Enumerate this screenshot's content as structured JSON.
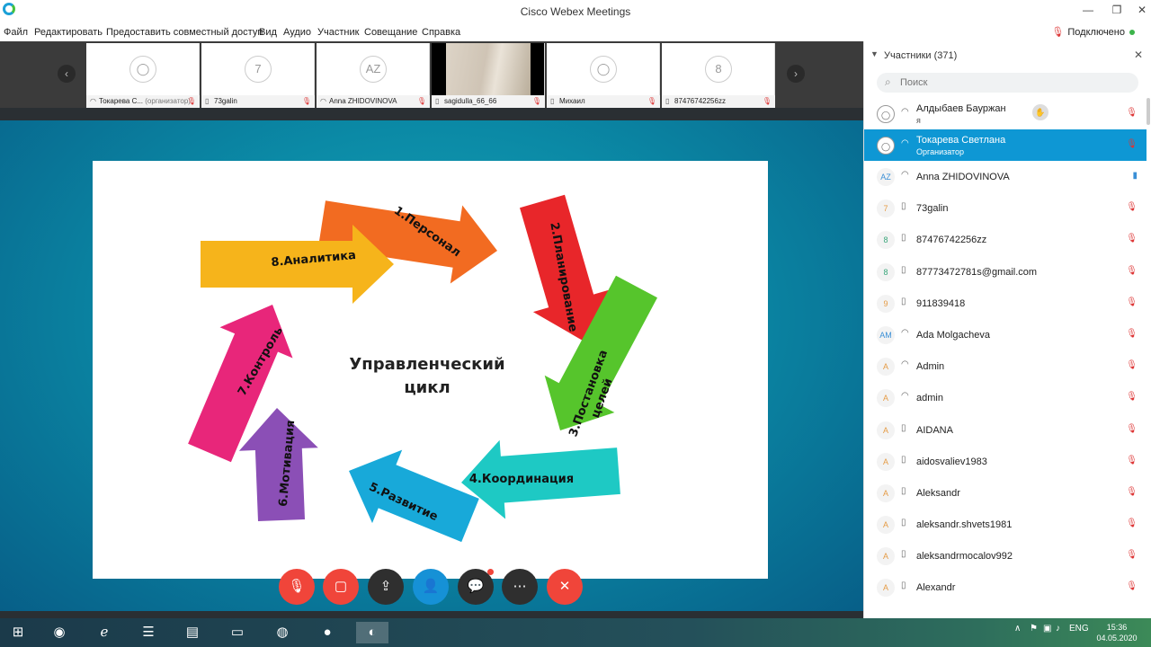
{
  "window": {
    "title": "Cisco Webex Meetings",
    "min": "—",
    "max": "❐",
    "close": "✕"
  },
  "menu": [
    "Файл",
    "Редактировать",
    "Предоставить совместный доступ",
    "Вид",
    "Аудио",
    "Участник",
    "Совещание",
    "Справка"
  ],
  "connection": {
    "label": "Подключено",
    "color": "#3cb44b"
  },
  "strip": {
    "prev": "‹",
    "next": "›",
    "thumbs": [
      {
        "avatar": "",
        "name": "Токарева С...",
        "role": "(организатор)",
        "device": "headset",
        "muted": true,
        "video": false
      },
      {
        "avatar": "7",
        "name": "73galin",
        "role": "",
        "device": "phone",
        "muted": true,
        "video": false
      },
      {
        "avatar": "AZ",
        "name": "Anna ZHIDOVINOVA",
        "role": "",
        "device": "headset",
        "muted": true,
        "video": false
      },
      {
        "avatar": "",
        "name": "sagidulla_66_66",
        "role": "",
        "device": "phone",
        "muted": true,
        "video": true
      },
      {
        "avatar": "",
        "name": "Михаил",
        "role": "",
        "device": "phone",
        "muted": true,
        "video": false
      },
      {
        "avatar": "8",
        "name": "87476742256zz",
        "role": "",
        "device": "phone",
        "muted": true,
        "video": false
      }
    ]
  },
  "slide": {
    "center_text": [
      "Управленческий",
      "цикл"
    ],
    "steps": [
      {
        "label": "1.Персонал",
        "color": "#f26b21"
      },
      {
        "label": "2.Планирование",
        "color": "#e8262a"
      },
      {
        "label": "3.Постановка",
        "label2": "целей",
        "color": "#56c52c"
      },
      {
        "label": "4.Координация",
        "color": "#1ec9c4"
      },
      {
        "label": "5.Развитие",
        "color": "#18a9d9"
      },
      {
        "label": "6.Мотивация",
        "color": "#8b4fb6"
      },
      {
        "label": "7.Контроль",
        "color": "#e8267a"
      },
      {
        "label": "8.Аналитика",
        "color": "#f6b41b"
      }
    ]
  },
  "controls": [
    {
      "name": "mute-button",
      "icon": "🎙",
      "style": "red"
    },
    {
      "name": "video-button",
      "icon": "▢",
      "style": "red"
    },
    {
      "name": "share-button",
      "icon": "⇪",
      "style": "dark"
    },
    {
      "name": "participants-button",
      "icon": "👤",
      "style": "blue"
    },
    {
      "name": "chat-button",
      "icon": "💬",
      "style": "dark"
    },
    {
      "name": "more-button",
      "icon": "⋯",
      "style": "dark"
    },
    {
      "name": "leave-button",
      "icon": "✕",
      "style": "red"
    }
  ],
  "panel": {
    "title": "Участники (371)",
    "search_placeholder": "Поиск",
    "participants": [
      {
        "avatar": "",
        "name": "Алдыбаев Бауржан",
        "sub": "я",
        "device": "headset",
        "mic": "muted",
        "hand": true,
        "selected": false
      },
      {
        "avatar": "",
        "name": "Токарева Светлана",
        "sub": "Организатор",
        "device": "headset",
        "mic": "muted",
        "hand": false,
        "selected": true
      },
      {
        "avatar": "AZ",
        "name": "Anna ZHIDOVINOVA",
        "sub": "",
        "device": "headset",
        "mic": "on",
        "hand": false,
        "selected": false
      },
      {
        "avatar": "7",
        "name": "73galin",
        "sub": "",
        "device": "phone",
        "mic": "muted",
        "hand": false,
        "selected": false
      },
      {
        "avatar": "8",
        "name": "87476742256zz",
        "sub": "",
        "device": "phone",
        "mic": "muted",
        "hand": false,
        "selected": false
      },
      {
        "avatar": "8",
        "name": "87773472781s@gmail.com",
        "sub": "",
        "device": "phone",
        "mic": "muted",
        "hand": false,
        "selected": false
      },
      {
        "avatar": "9",
        "name": "911839418",
        "sub": "",
        "device": "phone",
        "mic": "muted",
        "hand": false,
        "selected": false
      },
      {
        "avatar": "AM",
        "name": "Ada Molgacheva",
        "sub": "",
        "device": "headset",
        "mic": "muted",
        "hand": false,
        "selected": false
      },
      {
        "avatar": "A",
        "name": "Admin",
        "sub": "",
        "device": "headset",
        "mic": "muted",
        "hand": false,
        "selected": false
      },
      {
        "avatar": "A",
        "name": "admin",
        "sub": "",
        "device": "headset",
        "mic": "muted",
        "hand": false,
        "selected": false
      },
      {
        "avatar": "A",
        "name": "AIDANA",
        "sub": "",
        "device": "phone",
        "mic": "muted",
        "hand": false,
        "selected": false
      },
      {
        "avatar": "A",
        "name": "aidosvaliev1983",
        "sub": "",
        "device": "phone",
        "mic": "muted",
        "hand": false,
        "selected": false
      },
      {
        "avatar": "A",
        "name": "Aleksandr",
        "sub": "",
        "device": "phone",
        "mic": "muted",
        "hand": false,
        "selected": false
      },
      {
        "avatar": "A",
        "name": "aleksandr.shvets1981",
        "sub": "",
        "device": "phone",
        "mic": "muted",
        "hand": false,
        "selected": false
      },
      {
        "avatar": "A",
        "name": "aleksandrmocalov992",
        "sub": "",
        "device": "phone",
        "mic": "muted",
        "hand": false,
        "selected": false
      },
      {
        "avatar": "A",
        "name": "Alexandr",
        "sub": "",
        "device": "phone",
        "mic": "muted",
        "hand": false,
        "selected": false
      }
    ]
  },
  "taskbar": {
    "apps": [
      "start",
      "firefox",
      "ie",
      "files",
      "winrar",
      "explorer",
      "chrome",
      "recorder",
      "webex"
    ],
    "lang": "ENG",
    "time": "15:36",
    "date": "04.05.2020"
  }
}
